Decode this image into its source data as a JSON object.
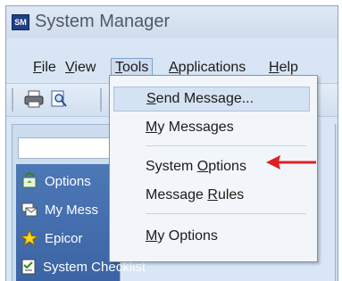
{
  "window": {
    "title": "System Manager",
    "app_icon_text": "SM"
  },
  "menubar": {
    "items": [
      {
        "label": "File",
        "underline": "F"
      },
      {
        "label": "View",
        "underline": "V"
      },
      {
        "label": "Tools",
        "underline": "T"
      },
      {
        "label": "Applications",
        "underline": "A"
      },
      {
        "label": "Help",
        "underline": "H"
      }
    ],
    "active": "Tools"
  },
  "tools_menu": {
    "items": [
      {
        "label": "Send Message...",
        "underline": "S"
      },
      {
        "label": "My Messages",
        "underline": "M"
      },
      {
        "label": "System Options",
        "underline": "O"
      },
      {
        "label": "Message Rules",
        "underline": "R"
      },
      {
        "label": "My Options",
        "underline": "M"
      }
    ],
    "highlighted": "Send Message..."
  },
  "sidebar": {
    "items": [
      {
        "label": "Options",
        "icon": "options-icon"
      },
      {
        "label": "My Mess",
        "icon": "messages-icon"
      },
      {
        "label": "Epicor",
        "icon": "star-icon"
      },
      {
        "label": "System Checklist",
        "icon": "checklist-icon"
      }
    ]
  },
  "toolbar": {
    "buttons": [
      {
        "icon": "print-icon"
      },
      {
        "icon": "print-preview-icon"
      }
    ]
  },
  "annotation": {
    "arrow_color": "#e02020"
  }
}
